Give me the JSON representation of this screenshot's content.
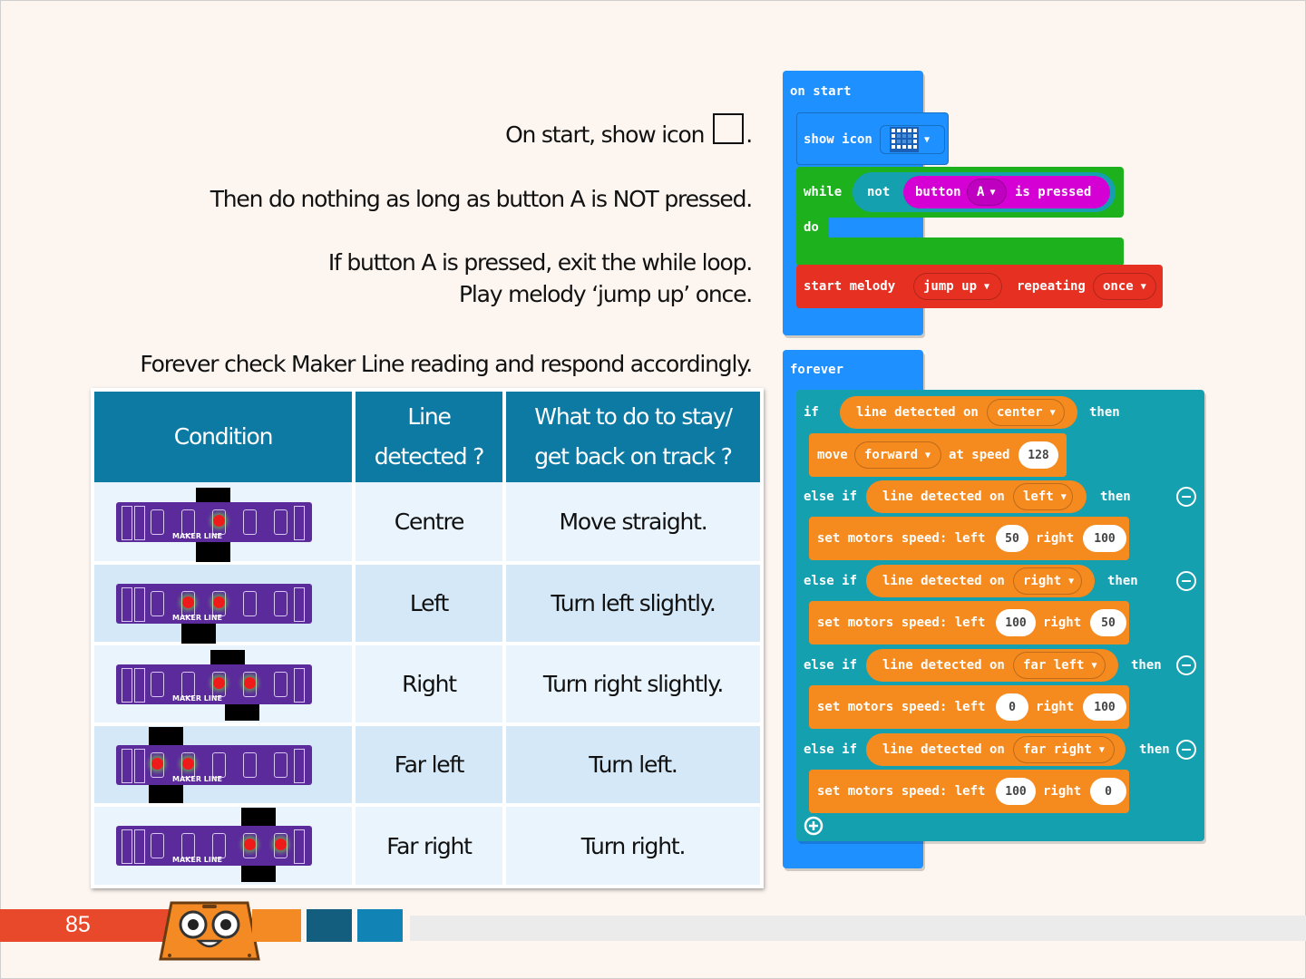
{
  "instructions": {
    "line1": "On start, show icon",
    "line1_end": ".",
    "line2": "Then do nothing as long as button A is NOT pressed.",
    "line3a": "If button A is pressed, exit the while loop.",
    "line3b": "Play melody ‘jump up’ once.",
    "line4": "Forever check Maker Line reading and respond accordingly."
  },
  "table": {
    "headers": {
      "condition": "Condition",
      "line_a": "Line",
      "line_b": "detected ?",
      "todo_a": "What to do to stay/",
      "todo_b": "get back on track ?"
    },
    "rows": [
      {
        "line": "Centre",
        "action": "Move straight.",
        "leds": [
          3
        ]
      },
      {
        "line": "Left",
        "action": "Turn left slightly.",
        "leds": [
          2,
          3
        ]
      },
      {
        "line": "Right",
        "action": "Turn right slightly.",
        "leds": [
          3,
          4
        ]
      },
      {
        "line": "Far left",
        "action": "Turn left.",
        "leds": [
          1,
          2
        ]
      },
      {
        "line": "Far right",
        "action": "Turn right.",
        "leds": [
          4,
          5
        ]
      }
    ],
    "pcb_label": "MAKER LINE"
  },
  "blocks": {
    "on_start": "on start",
    "show_icon": "show icon",
    "while": "while",
    "not": "not",
    "button": "button",
    "button_value": "A",
    "is_pressed": "is pressed",
    "do": "do",
    "start_melody": "start melody",
    "melody": "jump up",
    "repeating": "repeating",
    "repeat_value": "once",
    "forever": "forever",
    "if": "if",
    "else_if": "else if",
    "then": "then",
    "line_detected_on": "line detected on",
    "pos_center": "center",
    "pos_left": "left",
    "pos_right": "right",
    "pos_far_left": "far left",
    "pos_far_right": "far right",
    "move": "move",
    "direction": "forward",
    "at_speed": "at speed",
    "speed": "128",
    "set_motors": "set motors speed: left",
    "right_word": "right",
    "m1_left": "50",
    "m1_right": "100",
    "m2_left": "100",
    "m2_right": "50",
    "m3_left": "0",
    "m3_right": "100",
    "m4_left": "100",
    "m4_right": "0"
  },
  "footer": {
    "page_number": "85"
  },
  "colors": {
    "events": "#1e90ff",
    "loops": "#1db11d",
    "logic": "#15a0b0",
    "input": "#d400d4",
    "music": "#e63022",
    "maker": "#f58a1f",
    "table_header": "#0d7aa3"
  }
}
